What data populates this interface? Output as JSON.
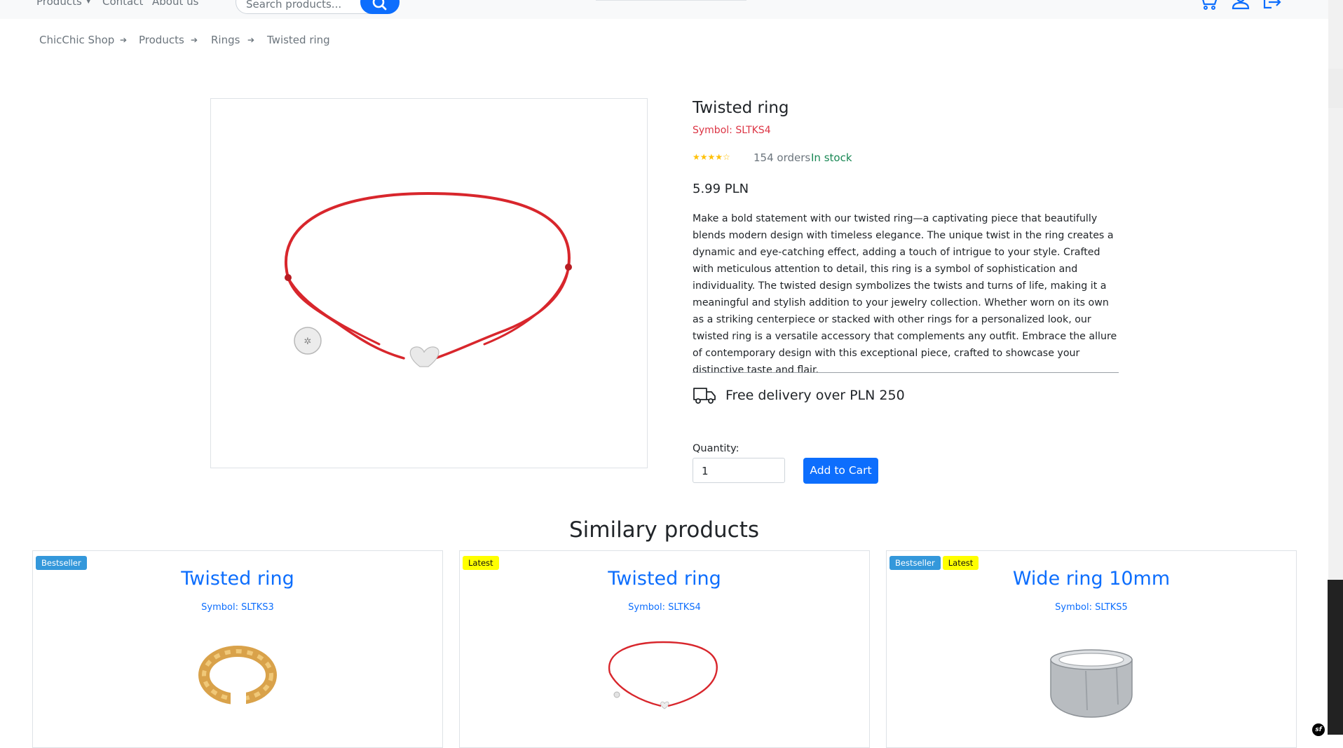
{
  "nav": {
    "links": [
      {
        "label": "Products",
        "has_dropdown": true
      },
      {
        "label": "Contact"
      },
      {
        "label": "About us"
      }
    ],
    "search_placeholder": "Search products...",
    "icons": [
      "cart-icon",
      "user-icon",
      "logout-icon"
    ]
  },
  "breadcrumb": [
    "ChicChic Shop",
    "Products",
    "Rings",
    "Twisted ring"
  ],
  "product": {
    "title": "Twisted ring",
    "symbol": "Symbol: SLTKS4",
    "rating_stars": "★★★★☆",
    "rating": 4,
    "orders": "154 orders",
    "stock": "In stock",
    "price": "5.99 PLN",
    "description": "Make a bold statement with our twisted ring—a captivating piece that beautifully blends modern design with timeless elegance. The unique twist in the ring creates a dynamic and eye-catching effect, adding a touch of intrigue to your style. Crafted with meticulous attention to detail, this ring is a symbol of sophistication and individuality. The twisted design symbolizes the twists and turns of life, making it a meaningful and stylish addition to your jewelry collection. Whether worn on its own as a striking centerpiece or stacked with other rings for a personalized look, our twisted ring is a versatile accessory that complements any outfit. Embrace the allure of contemporary design with this exceptional piece, crafted to showcase your distinctive taste and flair.",
    "delivery": "Free delivery over PLN 250",
    "quantity_label": "Quantity:",
    "quantity_value": "1",
    "add_to_cart": "Add to Cart",
    "image_icon": "red-cord-bracelet-image"
  },
  "similar": {
    "title": "Similary products",
    "items": [
      {
        "badges": [
          "Bestseller"
        ],
        "name": "Twisted ring",
        "symbol": "Symbol: SLTKS3",
        "image_icon": "gold-twisted-ring-image"
      },
      {
        "badges": [
          "Latest"
        ],
        "name": "Twisted ring",
        "symbol": "Symbol: SLTKS4",
        "image_icon": "red-cord-bracelet-image"
      },
      {
        "badges": [
          "Bestseller",
          "Latest"
        ],
        "name": "Wide ring 10mm",
        "symbol": "Symbol: SLTKS5",
        "image_icon": "silver-wide-ring-image"
      }
    ]
  },
  "colors": {
    "primary": "#0d6efd",
    "danger": "#dc3545",
    "success": "#198754",
    "badge_bestseller": "#3498db",
    "badge_latest": "#ffff00",
    "cord_red": "#d8262c"
  }
}
